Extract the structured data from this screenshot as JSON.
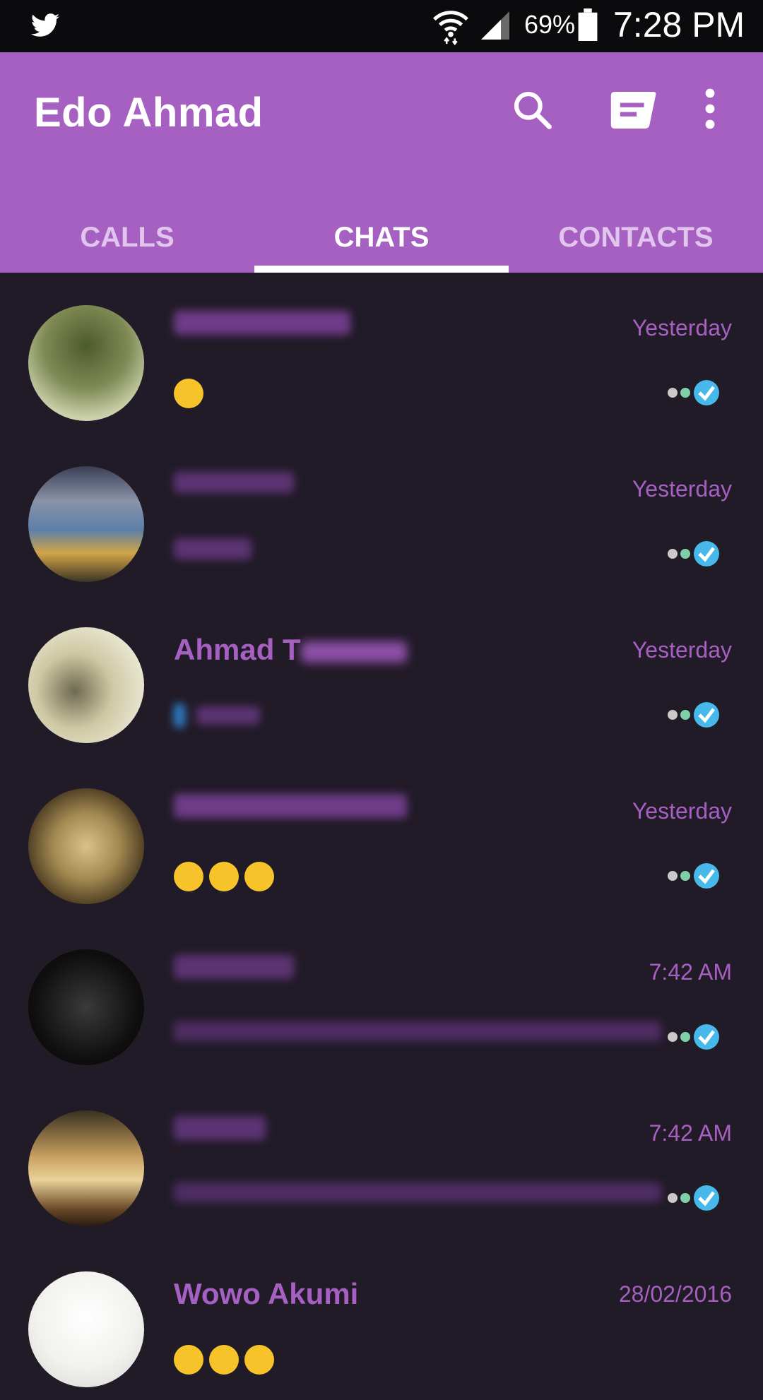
{
  "status_bar": {
    "battery_percent": "69%",
    "time": "7:28 PM",
    "icons": [
      "twitter-icon",
      "wifi-icon",
      "signal-icon",
      "battery-icon"
    ]
  },
  "app_bar": {
    "title": "Edo Ahmad",
    "actions": [
      "search-icon",
      "compose-icon",
      "overflow-menu-icon"
    ]
  },
  "tabs": [
    {
      "label": "CALLS",
      "selected": false
    },
    {
      "label": "CHATS",
      "selected": true
    },
    {
      "label": "CONTACTS",
      "selected": false
    }
  ],
  "chats": [
    {
      "name": "",
      "time": "Yesterday",
      "preview": "",
      "preview_emoji_count": 1
    },
    {
      "name": "",
      "time": "Yesterday",
      "preview": "",
      "preview_emoji_count": 0
    },
    {
      "name": "Ahmad T",
      "time": "Yesterday",
      "preview": "",
      "preview_emoji_count": 0
    },
    {
      "name": "",
      "time": "Yesterday",
      "preview": "",
      "preview_emoji_count": 3
    },
    {
      "name": "",
      "time": "7:42 AM",
      "preview": "",
      "preview_emoji_count": 0
    },
    {
      "name": "",
      "time": "7:42 AM",
      "preview": "",
      "preview_emoji_count": 0
    },
    {
      "name": "Wowo Akumi",
      "time": "28/02/2016",
      "preview": "",
      "preview_emoji_count": 3
    }
  ],
  "colors": {
    "accent": "#a660c2",
    "background": "#211a27",
    "status_bar": "#0b0a0d",
    "read_tick": "#47b8ea"
  }
}
